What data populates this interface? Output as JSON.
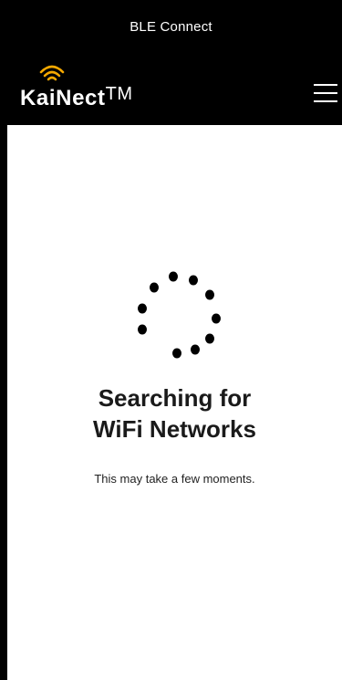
{
  "header": {
    "title": "BLE Connect",
    "logo_name": "KaiNect",
    "logo_tm": "TM",
    "menu_icon": "hamburger-menu-icon",
    "logo_icon": "wifi-signal-icon",
    "logo_accent_color": "#F5A800",
    "background_color": "#000000"
  },
  "main": {
    "spinner_icon": "loading-spinner-icon",
    "heading_line1": "Searching for",
    "heading_line2": "WiFi Networks",
    "subtext": "This may take a few moments."
  }
}
